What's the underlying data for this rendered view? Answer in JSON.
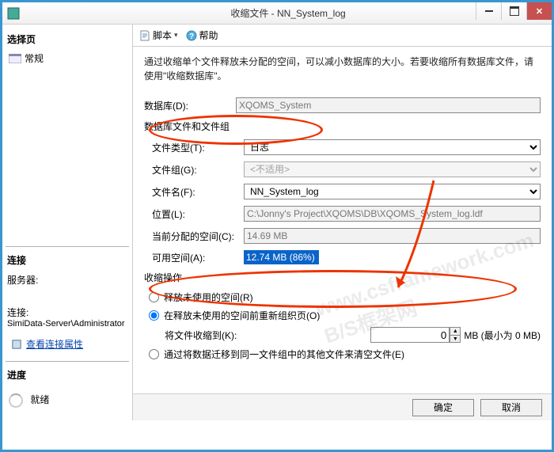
{
  "window": {
    "title": "收缩文件 - NN_System_log"
  },
  "sidebar": {
    "select_page": "选择页",
    "general": "常规",
    "connection_h": "连接",
    "server_lbl": "服务器:",
    "server_val": "",
    "conn_lbl": "连接:",
    "conn_val": "SimiData-Server\\Administrator",
    "view_props": "查看连接属性",
    "progress_h": "进度",
    "ready": "就绪"
  },
  "toolbar": {
    "script": "脚本",
    "help": "帮助"
  },
  "description": "通过收缩单个文件释放未分配的空间，可以减小数据库的大小。若要收缩所有数据库文件，请使用\"收缩数据库\"。",
  "form": {
    "database_lbl": "数据库(D):",
    "database_val": "XQOMS_System",
    "group_h": "数据库文件和文件组",
    "filetype_lbl": "文件类型(T):",
    "filetype_val": "日志",
    "filegroup_lbl": "文件组(G):",
    "filegroup_val": "<不适用>",
    "filename_lbl": "文件名(F):",
    "filename_val": "NN_System_log",
    "location_lbl": "位置(L):",
    "location_val": "C:\\Jonny's Project\\XQOMS\\DB\\XQOMS_System_log.ldf",
    "alloc_lbl": "当前分配的空间(C):",
    "alloc_val": "14.69 MB",
    "avail_lbl": "可用空间(A):",
    "avail_val": "12.74 MB (86%)"
  },
  "shrink": {
    "section": "收缩操作",
    "opt1": "释放未使用的空间(R)",
    "opt2": "在释放未使用的空间前重新组织页(O)",
    "shrinkto_lbl": "将文件收缩到(K):",
    "shrinkto_val": "0",
    "shrinkto_unit": "MB (最小为 0 MB)",
    "opt3": "通过将数据迁移到同一文件组中的其他文件来清空文件(E)"
  },
  "footer": {
    "ok": "确定",
    "cancel": "取消"
  },
  "watermark": "www.csframework.com B/S框架网"
}
